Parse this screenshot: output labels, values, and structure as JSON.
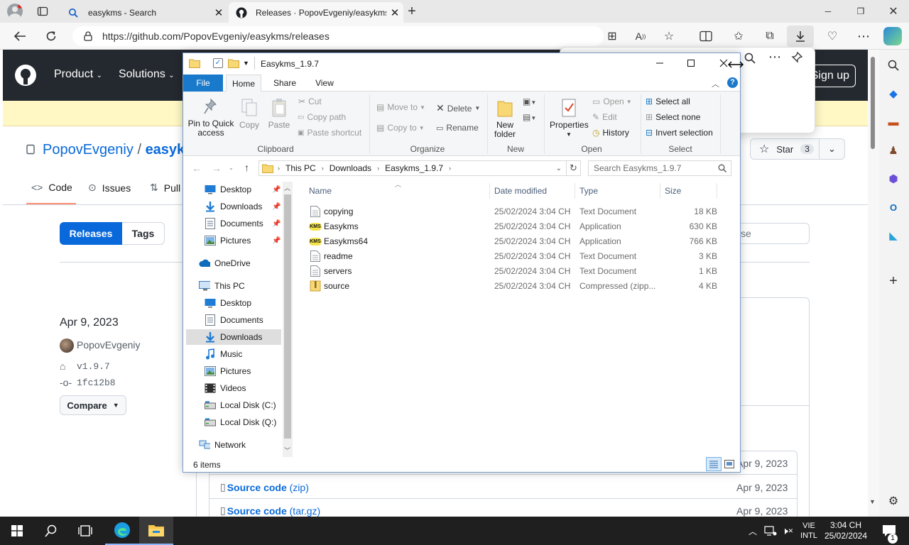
{
  "browser": {
    "tabs": [
      {
        "title": "easykms - Search"
      },
      {
        "title": "Releases · PopovEvgeniy/easykms"
      }
    ],
    "url": "https://github.com/PopovEvgeniy/easykms/releases"
  },
  "github": {
    "nav": [
      "Product",
      "Solutions"
    ],
    "sign_up": "Sign up",
    "owner": "PopovEvgeniy",
    "sep": "/",
    "repo": "easykms",
    "star_label": "Star",
    "star_count": "3",
    "tabs": [
      "Code",
      "Issues",
      "Pull"
    ],
    "releases_btn": "Releases",
    "tags_btn": "Tags",
    "search_partial": "se",
    "release_date": "Apr 9, 2023",
    "author": "PopovEvgeniy",
    "tag": "v1.9.7",
    "commit": "1fc12b8",
    "compare": "Compare",
    "assets": [
      {
        "name": "Source code",
        "ext": "(zip)",
        "date": "Apr 9, 2023"
      },
      {
        "name": "Source code",
        "ext": "(tar.gz)",
        "date": "Apr 9, 2023"
      }
    ],
    "asset_top_date": "Apr 9, 2023"
  },
  "explorer": {
    "title": "Easykms_1.9.7",
    "ribbon_tabs": [
      "File",
      "Home",
      "Share",
      "View"
    ],
    "clipboard": {
      "pin": "Pin to Quick access",
      "copy": "Copy",
      "paste": "Paste",
      "cut": "Cut",
      "copy_path": "Copy path",
      "paste_shortcut": "Paste shortcut",
      "group": "Clipboard"
    },
    "organize": {
      "move_to": "Move to",
      "copy_to": "Copy to",
      "delete": "Delete",
      "rename": "Rename",
      "group": "Organize"
    },
    "new": {
      "new_folder": "New folder",
      "group": "New"
    },
    "open": {
      "properties": "Properties",
      "open": "Open",
      "edit": "Edit",
      "history": "History",
      "group": "Open"
    },
    "select": {
      "select_all": "Select all",
      "select_none": "Select none",
      "invert": "Invert selection",
      "group": "Select"
    },
    "path": [
      "This PC",
      "Downloads",
      "Easykms_1.9.7"
    ],
    "search_placeholder": "Search Easykms_1.9.7",
    "nav": [
      {
        "label": "Desktop",
        "pinned": true
      },
      {
        "label": "Downloads",
        "pinned": true
      },
      {
        "label": "Documents",
        "pinned": true
      },
      {
        "label": "Pictures",
        "pinned": true
      },
      {
        "label": "OneDrive"
      },
      {
        "label": "This PC"
      },
      {
        "label": "Desktop"
      },
      {
        "label": "Documents"
      },
      {
        "label": "Downloads",
        "selected": true
      },
      {
        "label": "Music"
      },
      {
        "label": "Pictures"
      },
      {
        "label": "Videos"
      },
      {
        "label": "Local Disk (C:)"
      },
      {
        "label": "Local Disk (Q:)"
      },
      {
        "label": "Network"
      }
    ],
    "columns": [
      "Name",
      "Date modified",
      "Type",
      "Size"
    ],
    "files": [
      {
        "name": "copying",
        "date": "25/02/2024 3:04 CH",
        "type": "Text Document",
        "size": "18 KB",
        "icon": "text-file-icon"
      },
      {
        "name": "Easykms",
        "date": "25/02/2024 3:04 CH",
        "type": "Application",
        "size": "630 KB",
        "icon": "kms-app-icon"
      },
      {
        "name": "Easykms64",
        "date": "25/02/2024 3:04 CH",
        "type": "Application",
        "size": "766 KB",
        "icon": "kms-app-icon"
      },
      {
        "name": "readme",
        "date": "25/02/2024 3:04 CH",
        "type": "Text Document",
        "size": "3 KB",
        "icon": "text-file-icon"
      },
      {
        "name": "servers",
        "date": "25/02/2024 3:04 CH",
        "type": "Text Document",
        "size": "1 KB",
        "icon": "text-file-icon"
      },
      {
        "name": "source",
        "date": "25/02/2024 3:04 CH",
        "type": "Compressed (zipp...",
        "size": "4 KB",
        "icon": "zip-folder-icon"
      }
    ],
    "status": "6 items",
    "kms_label": "KMS"
  },
  "taskbar": {
    "lang_top": "VIE",
    "lang_bottom": "INTL",
    "time": "3:04 CH",
    "date": "25/02/2024",
    "notif_count": "1"
  },
  "colors": {
    "github_header": "#24292f",
    "accent_blue": "#0969da",
    "file_tab": "#1979ca",
    "taskbar": "#1f1f1f"
  }
}
